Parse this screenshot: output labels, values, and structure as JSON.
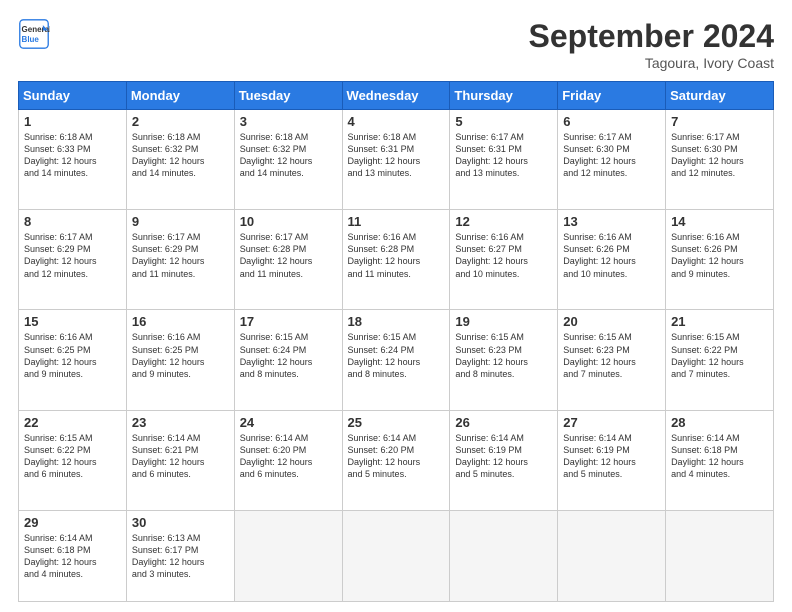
{
  "header": {
    "logo_line1": "General",
    "logo_line2": "Blue",
    "month_title": "September 2024",
    "location": "Tagoura, Ivory Coast"
  },
  "weekdays": [
    "Sunday",
    "Monday",
    "Tuesday",
    "Wednesday",
    "Thursday",
    "Friday",
    "Saturday"
  ],
  "weeks": [
    [
      {
        "day": "1",
        "lines": [
          "Sunrise: 6:18 AM",
          "Sunset: 6:33 PM",
          "Daylight: 12 hours",
          "and 14 minutes."
        ]
      },
      {
        "day": "2",
        "lines": [
          "Sunrise: 6:18 AM",
          "Sunset: 6:32 PM",
          "Daylight: 12 hours",
          "and 14 minutes."
        ]
      },
      {
        "day": "3",
        "lines": [
          "Sunrise: 6:18 AM",
          "Sunset: 6:32 PM",
          "Daylight: 12 hours",
          "and 14 minutes."
        ]
      },
      {
        "day": "4",
        "lines": [
          "Sunrise: 6:18 AM",
          "Sunset: 6:31 PM",
          "Daylight: 12 hours",
          "and 13 minutes."
        ]
      },
      {
        "day": "5",
        "lines": [
          "Sunrise: 6:17 AM",
          "Sunset: 6:31 PM",
          "Daylight: 12 hours",
          "and 13 minutes."
        ]
      },
      {
        "day": "6",
        "lines": [
          "Sunrise: 6:17 AM",
          "Sunset: 6:30 PM",
          "Daylight: 12 hours",
          "and 12 minutes."
        ]
      },
      {
        "day": "7",
        "lines": [
          "Sunrise: 6:17 AM",
          "Sunset: 6:30 PM",
          "Daylight: 12 hours",
          "and 12 minutes."
        ]
      }
    ],
    [
      {
        "day": "8",
        "lines": [
          "Sunrise: 6:17 AM",
          "Sunset: 6:29 PM",
          "Daylight: 12 hours",
          "and 12 minutes."
        ]
      },
      {
        "day": "9",
        "lines": [
          "Sunrise: 6:17 AM",
          "Sunset: 6:29 PM",
          "Daylight: 12 hours",
          "and 11 minutes."
        ]
      },
      {
        "day": "10",
        "lines": [
          "Sunrise: 6:17 AM",
          "Sunset: 6:28 PM",
          "Daylight: 12 hours",
          "and 11 minutes."
        ]
      },
      {
        "day": "11",
        "lines": [
          "Sunrise: 6:16 AM",
          "Sunset: 6:28 PM",
          "Daylight: 12 hours",
          "and 11 minutes."
        ]
      },
      {
        "day": "12",
        "lines": [
          "Sunrise: 6:16 AM",
          "Sunset: 6:27 PM",
          "Daylight: 12 hours",
          "and 10 minutes."
        ]
      },
      {
        "day": "13",
        "lines": [
          "Sunrise: 6:16 AM",
          "Sunset: 6:26 PM",
          "Daylight: 12 hours",
          "and 10 minutes."
        ]
      },
      {
        "day": "14",
        "lines": [
          "Sunrise: 6:16 AM",
          "Sunset: 6:26 PM",
          "Daylight: 12 hours",
          "and 9 minutes."
        ]
      }
    ],
    [
      {
        "day": "15",
        "lines": [
          "Sunrise: 6:16 AM",
          "Sunset: 6:25 PM",
          "Daylight: 12 hours",
          "and 9 minutes."
        ]
      },
      {
        "day": "16",
        "lines": [
          "Sunrise: 6:16 AM",
          "Sunset: 6:25 PM",
          "Daylight: 12 hours",
          "and 9 minutes."
        ]
      },
      {
        "day": "17",
        "lines": [
          "Sunrise: 6:15 AM",
          "Sunset: 6:24 PM",
          "Daylight: 12 hours",
          "and 8 minutes."
        ]
      },
      {
        "day": "18",
        "lines": [
          "Sunrise: 6:15 AM",
          "Sunset: 6:24 PM",
          "Daylight: 12 hours",
          "and 8 minutes."
        ]
      },
      {
        "day": "19",
        "lines": [
          "Sunrise: 6:15 AM",
          "Sunset: 6:23 PM",
          "Daylight: 12 hours",
          "and 8 minutes."
        ]
      },
      {
        "day": "20",
        "lines": [
          "Sunrise: 6:15 AM",
          "Sunset: 6:23 PM",
          "Daylight: 12 hours",
          "and 7 minutes."
        ]
      },
      {
        "day": "21",
        "lines": [
          "Sunrise: 6:15 AM",
          "Sunset: 6:22 PM",
          "Daylight: 12 hours",
          "and 7 minutes."
        ]
      }
    ],
    [
      {
        "day": "22",
        "lines": [
          "Sunrise: 6:15 AM",
          "Sunset: 6:22 PM",
          "Daylight: 12 hours",
          "and 6 minutes."
        ]
      },
      {
        "day": "23",
        "lines": [
          "Sunrise: 6:14 AM",
          "Sunset: 6:21 PM",
          "Daylight: 12 hours",
          "and 6 minutes."
        ]
      },
      {
        "day": "24",
        "lines": [
          "Sunrise: 6:14 AM",
          "Sunset: 6:20 PM",
          "Daylight: 12 hours",
          "and 6 minutes."
        ]
      },
      {
        "day": "25",
        "lines": [
          "Sunrise: 6:14 AM",
          "Sunset: 6:20 PM",
          "Daylight: 12 hours",
          "and 5 minutes."
        ]
      },
      {
        "day": "26",
        "lines": [
          "Sunrise: 6:14 AM",
          "Sunset: 6:19 PM",
          "Daylight: 12 hours",
          "and 5 minutes."
        ]
      },
      {
        "day": "27",
        "lines": [
          "Sunrise: 6:14 AM",
          "Sunset: 6:19 PM",
          "Daylight: 12 hours",
          "and 5 minutes."
        ]
      },
      {
        "day": "28",
        "lines": [
          "Sunrise: 6:14 AM",
          "Sunset: 6:18 PM",
          "Daylight: 12 hours",
          "and 4 minutes."
        ]
      }
    ],
    [
      {
        "day": "29",
        "lines": [
          "Sunrise: 6:14 AM",
          "Sunset: 6:18 PM",
          "Daylight: 12 hours",
          "and 4 minutes."
        ]
      },
      {
        "day": "30",
        "lines": [
          "Sunrise: 6:13 AM",
          "Sunset: 6:17 PM",
          "Daylight: 12 hours",
          "and 3 minutes."
        ]
      },
      {
        "day": "",
        "lines": []
      },
      {
        "day": "",
        "lines": []
      },
      {
        "day": "",
        "lines": []
      },
      {
        "day": "",
        "lines": []
      },
      {
        "day": "",
        "lines": []
      }
    ]
  ]
}
